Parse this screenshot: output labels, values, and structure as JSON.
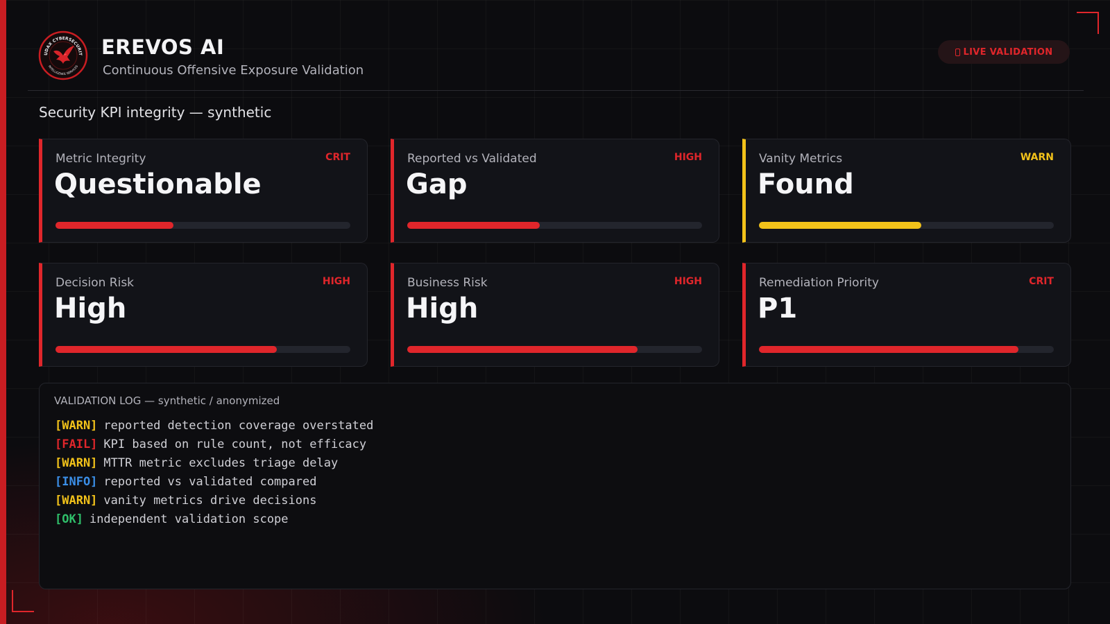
{
  "colors": {
    "accent_red": "#e0262b",
    "warn_yellow": "#f2c21a",
    "info_blue": "#3b8fe8",
    "ok_green": "#2fbf6a",
    "background": "#0c0c0f"
  },
  "header": {
    "logo_icon": "audax-cybersecurity-eagle-logo",
    "logo_text_top": "AUDAX CYBERSECURITY",
    "logo_text_bottom": "INTELLIGENCE SERVICES",
    "title": "EREVOS AI",
    "subtitle": "Continuous Offensive Exposure Validation",
    "live_badge": {
      "icon": "lock-icon",
      "label": "LIVE VALIDATION"
    }
  },
  "section_title": "Security KPI integrity — synthetic",
  "kpi_cards": [
    {
      "label": "Metric Integrity",
      "severity": "CRIT",
      "value": "Questionable",
      "level": 0.4
    },
    {
      "label": "Reported vs Validated",
      "severity": "HIGH",
      "value": "Gap",
      "level": 0.45
    },
    {
      "label": "Vanity Metrics",
      "severity": "WARN",
      "value": "Found",
      "level": 0.55
    },
    {
      "label": "Decision Risk",
      "severity": "HIGH",
      "value": "High",
      "level": 0.75
    },
    {
      "label": "Business Risk",
      "severity": "HIGH",
      "value": "High",
      "level": 0.78
    },
    {
      "label": "Remediation Priority",
      "severity": "CRIT",
      "value": "P1",
      "level": 0.88
    }
  ],
  "log": {
    "title": "VALIDATION LOG — synthetic / anonymized",
    "lines": [
      {
        "tag": "[WARN]",
        "level": "warn",
        "message": "reported detection coverage overstated"
      },
      {
        "tag": "[FAIL]",
        "level": "fail",
        "message": "KPI based on rule count, not efficacy"
      },
      {
        "tag": "[WARN]",
        "level": "warn",
        "message": "MTTR metric excludes triage delay"
      },
      {
        "tag": "[INFO]",
        "level": "info",
        "message": "reported vs validated compared"
      },
      {
        "tag": "[WARN]",
        "level": "warn",
        "message": "vanity metrics drive decisions"
      },
      {
        "tag": "[OK]",
        "level": "ok",
        "message": "independent validation scope"
      }
    ]
  }
}
